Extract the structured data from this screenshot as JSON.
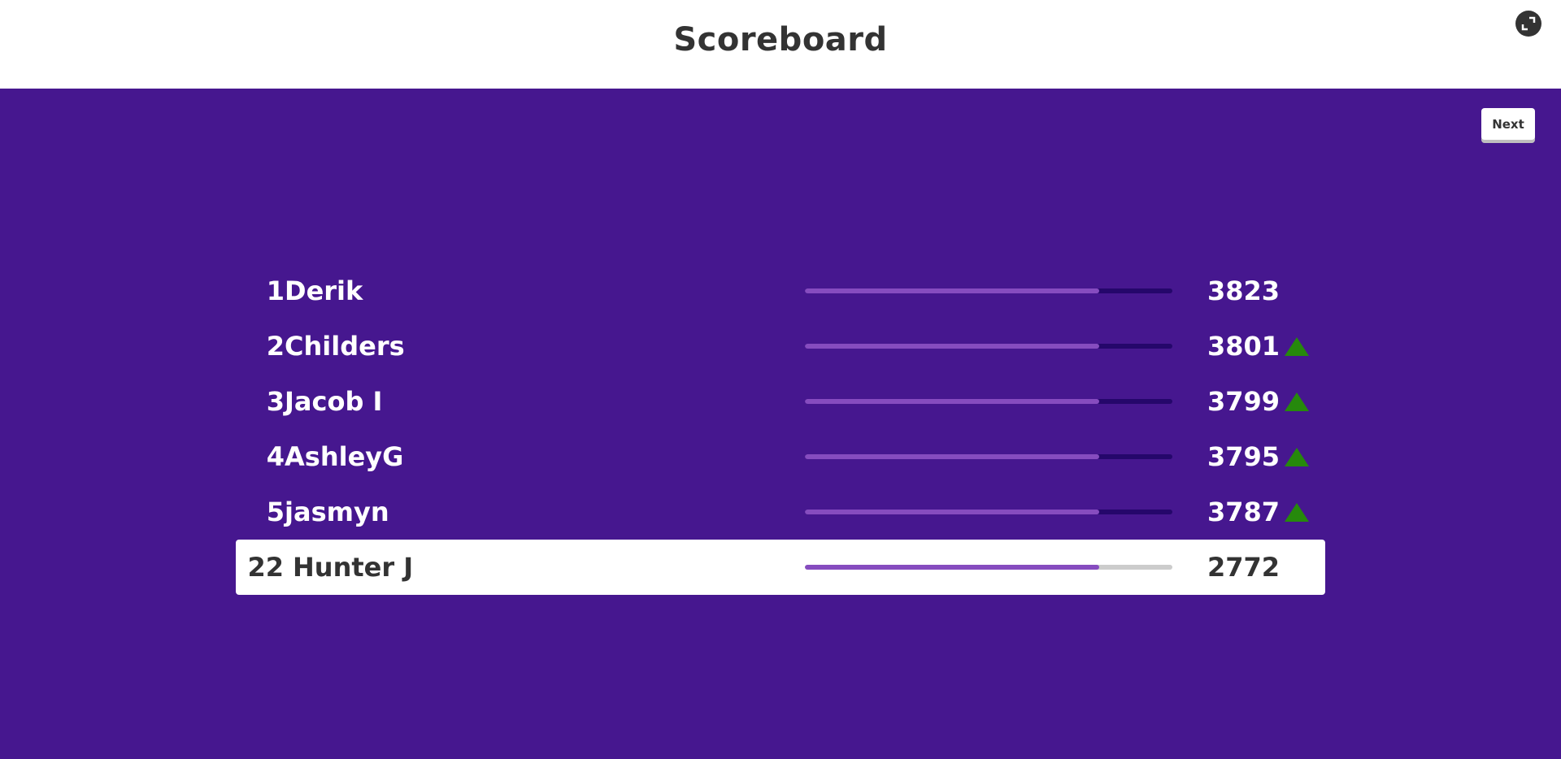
{
  "header": {
    "title": "Scoreboard"
  },
  "controls": {
    "next_label": "Next",
    "fullscreen_icon": "fullscreen-icon"
  },
  "colors": {
    "background": "#46178f",
    "bar_fill": "#864cbf",
    "bar_track": "#25076b",
    "trend_up": "#26890c"
  },
  "leaderboard": [
    {
      "rank": "1",
      "name": "Derik",
      "score": "3823",
      "progress": 0.8,
      "trend": "none"
    },
    {
      "rank": "2",
      "name": "Childers",
      "score": "3801",
      "progress": 0.8,
      "trend": "up"
    },
    {
      "rank": "3",
      "name": "Jacob I",
      "score": "3799",
      "progress": 0.8,
      "trend": "up"
    },
    {
      "rank": "4",
      "name": "AshleyG",
      "score": "3795",
      "progress": 0.8,
      "trend": "up"
    },
    {
      "rank": "5",
      "name": "jasmyn",
      "score": "3787",
      "progress": 0.8,
      "trend": "up"
    },
    {
      "rank": "22",
      "name": "Hunter J",
      "score": "2772",
      "progress": 0.8,
      "trend": "none",
      "highlighted": true
    }
  ]
}
